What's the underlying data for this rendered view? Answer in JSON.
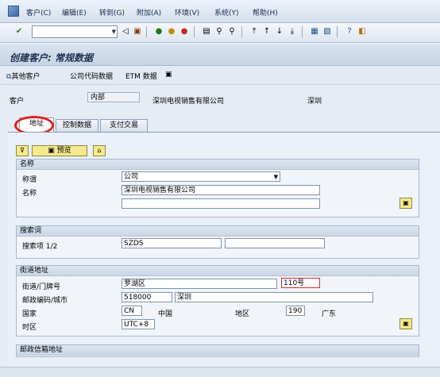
{
  "menu": [
    "客户(C)",
    "编辑(E)",
    "转到(G)",
    "附加(A)",
    "环境(V)",
    "系统(Y)",
    "帮助(H)"
  ],
  "title": "创建客户: 常规数据",
  "app_toolbar": {
    "other_customer": "其他客户",
    "company_code": "公司代码数据",
    "etm": "ETM 数据"
  },
  "header": {
    "customer_label": "客户",
    "customer_value": "内部",
    "name": "深圳电视销售有限公司",
    "city": "深圳"
  },
  "tabs": [
    "地址",
    "控制数据",
    "支付交易"
  ],
  "preview_label": "预览",
  "name_group": {
    "title": "名称",
    "salutation_label": "称谓",
    "salutation_value": "公司",
    "name_label": "名称",
    "name_value": "深圳电视销售有限公司",
    "name2_value": ""
  },
  "search_group": {
    "title": "搜索词",
    "label": "搜索项 1/2",
    "term1": "SZDS",
    "term2": ""
  },
  "street_group": {
    "title": "街道地址",
    "street_label": "街道/门牌号",
    "street_value": "罗湖区",
    "house_no": "110号",
    "postal_label": "邮政编码/城市",
    "postal_value": "518000",
    "city_value": "深圳",
    "country_label": "国家",
    "country_code": "CN",
    "country_name": "中国",
    "region_label": "地区",
    "region_code": "190",
    "region_name": "广东",
    "tz_label": "时区",
    "tz_value": "UTC+8"
  },
  "pobox_group": {
    "title": "邮政信箱地址"
  },
  "colors": {
    "highlight_circle": "#e2211c",
    "button_yellow": "#f6e98c"
  },
  "icons": [
    "sap-logo-icon",
    "enter-icon",
    "back-icon",
    "save-icon",
    "exit-icon",
    "cancel-icon",
    "print-icon",
    "find-icon",
    "page-icon",
    "new-session-icon",
    "help-icon",
    "customize-icon"
  ]
}
